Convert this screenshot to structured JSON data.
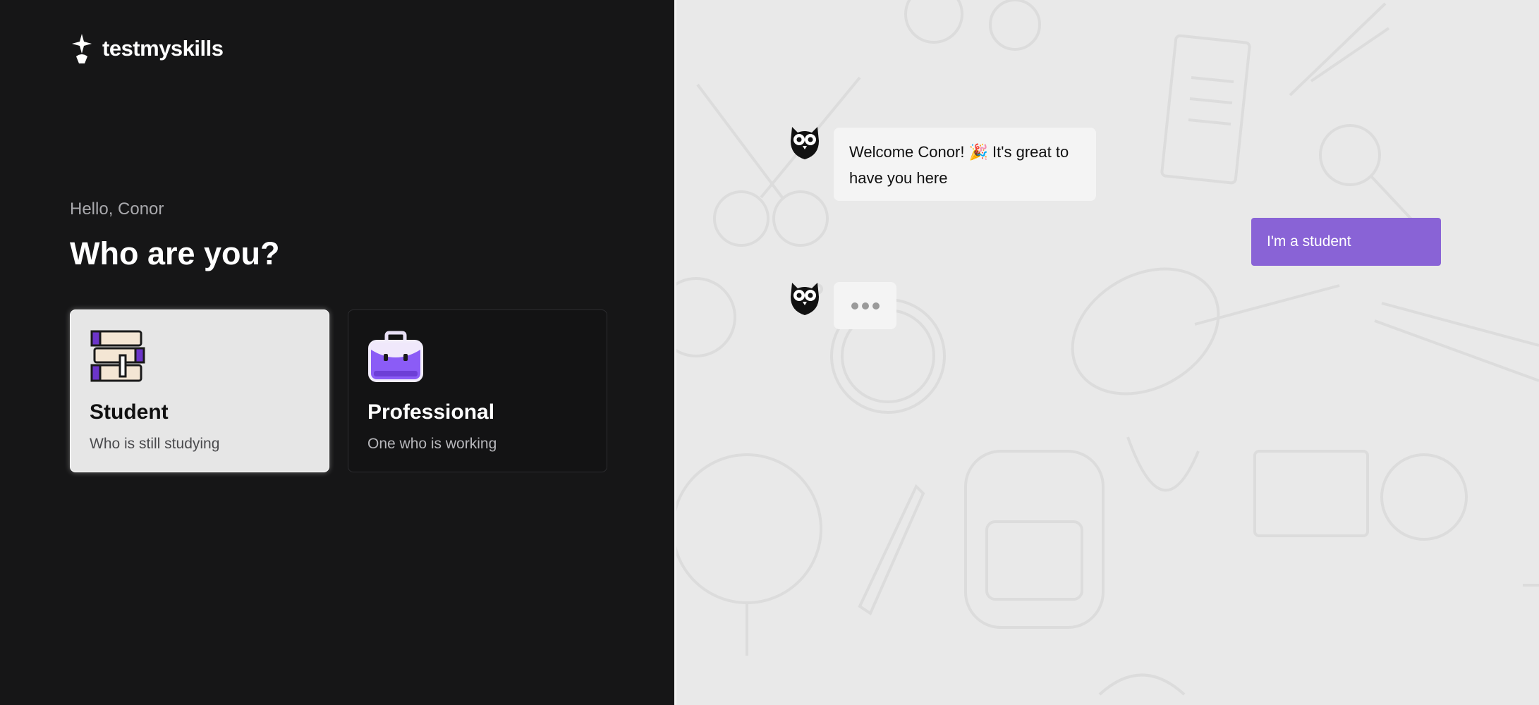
{
  "brand": {
    "name": "testmyskills"
  },
  "left": {
    "greeting": "Hello, Conor",
    "question": "Who are you?",
    "options": [
      {
        "title": "Student",
        "subtitle": "Who is still studying",
        "icon": "books-icon",
        "selected": true
      },
      {
        "title": "Professional",
        "subtitle": "One who is working",
        "icon": "briefcase-icon",
        "selected": false
      }
    ]
  },
  "chat": {
    "messages": [
      {
        "from": "bot",
        "text": "Welcome Conor! 🎉 It's great to have you here"
      },
      {
        "from": "user",
        "text": "I'm a student"
      },
      {
        "from": "bot",
        "typing": true
      }
    ],
    "avatar_icon": "owl-icon"
  },
  "colors": {
    "left_bg": "#161617",
    "right_bg": "#e9e9e9",
    "accent": "#8963d6",
    "card_selected_bg": "#e6e6e6"
  }
}
